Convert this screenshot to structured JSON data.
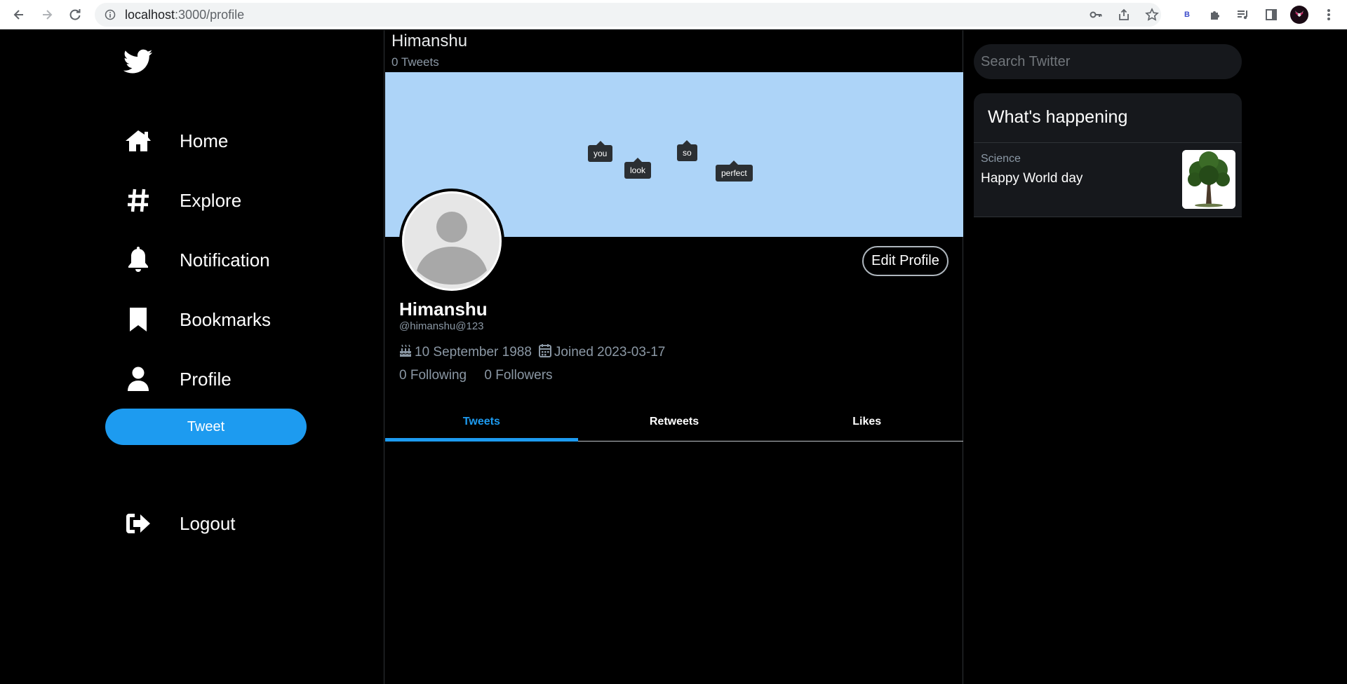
{
  "browser": {
    "url_host": "localhost",
    "url_path": ":3000/profile",
    "extension_badge": "B"
  },
  "sidebar": {
    "logo": "twitter-bird-icon",
    "items": [
      {
        "label": "Home",
        "icon": "home-icon"
      },
      {
        "label": "Explore",
        "icon": "hashtag-icon"
      },
      {
        "label": "Notification",
        "icon": "bell-icon"
      },
      {
        "label": "Bookmarks",
        "icon": "bookmark-icon"
      },
      {
        "label": "Profile",
        "icon": "user-icon"
      }
    ],
    "tweet_label": "Tweet",
    "logout_label": "Logout"
  },
  "header": {
    "name": "Himanshu",
    "tweet_count": "0 Tweets"
  },
  "banner": {
    "tags": [
      "you",
      "look",
      "so",
      "perfect"
    ]
  },
  "profile": {
    "edit_label": "Edit Profile",
    "name": "Himanshu",
    "handle": "@himanshu@123",
    "birthday": "10 September 1988",
    "joined": "Joined 2023-03-17",
    "following": "0 Following",
    "followers": "0 Followers"
  },
  "tabs": [
    {
      "label": "Tweets",
      "active": true
    },
    {
      "label": "Retweets",
      "active": false
    },
    {
      "label": "Likes",
      "active": false
    }
  ],
  "right": {
    "search_placeholder": "Search Twitter",
    "happening_title": "What's happening",
    "trend": {
      "category": "Science",
      "title": "Happy World day"
    }
  },
  "colors": {
    "accent": "#1d9bf0",
    "banner": "#add4f8",
    "background": "#000000"
  }
}
